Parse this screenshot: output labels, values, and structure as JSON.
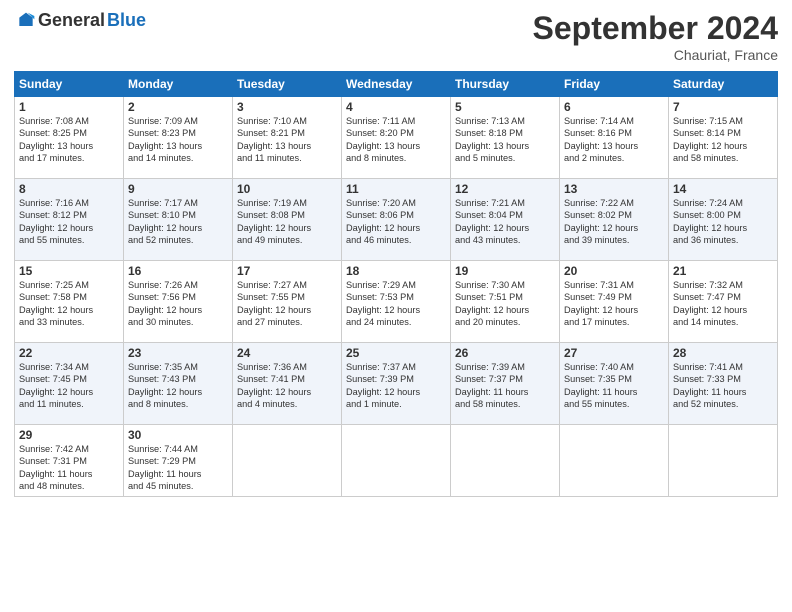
{
  "header": {
    "logo_general": "General",
    "logo_blue": "Blue",
    "month": "September 2024",
    "location": "Chauriat, France"
  },
  "weekdays": [
    "Sunday",
    "Monday",
    "Tuesday",
    "Wednesday",
    "Thursday",
    "Friday",
    "Saturday"
  ],
  "weeks": [
    [
      {
        "day": "1",
        "info": "Sunrise: 7:08 AM\nSunset: 8:25 PM\nDaylight: 13 hours\nand 17 minutes."
      },
      {
        "day": "2",
        "info": "Sunrise: 7:09 AM\nSunset: 8:23 PM\nDaylight: 13 hours\nand 14 minutes."
      },
      {
        "day": "3",
        "info": "Sunrise: 7:10 AM\nSunset: 8:21 PM\nDaylight: 13 hours\nand 11 minutes."
      },
      {
        "day": "4",
        "info": "Sunrise: 7:11 AM\nSunset: 8:20 PM\nDaylight: 13 hours\nand 8 minutes."
      },
      {
        "day": "5",
        "info": "Sunrise: 7:13 AM\nSunset: 8:18 PM\nDaylight: 13 hours\nand 5 minutes."
      },
      {
        "day": "6",
        "info": "Sunrise: 7:14 AM\nSunset: 8:16 PM\nDaylight: 13 hours\nand 2 minutes."
      },
      {
        "day": "7",
        "info": "Sunrise: 7:15 AM\nSunset: 8:14 PM\nDaylight: 12 hours\nand 58 minutes."
      }
    ],
    [
      {
        "day": "8",
        "info": "Sunrise: 7:16 AM\nSunset: 8:12 PM\nDaylight: 12 hours\nand 55 minutes."
      },
      {
        "day": "9",
        "info": "Sunrise: 7:17 AM\nSunset: 8:10 PM\nDaylight: 12 hours\nand 52 minutes."
      },
      {
        "day": "10",
        "info": "Sunrise: 7:19 AM\nSunset: 8:08 PM\nDaylight: 12 hours\nand 49 minutes."
      },
      {
        "day": "11",
        "info": "Sunrise: 7:20 AM\nSunset: 8:06 PM\nDaylight: 12 hours\nand 46 minutes."
      },
      {
        "day": "12",
        "info": "Sunrise: 7:21 AM\nSunset: 8:04 PM\nDaylight: 12 hours\nand 43 minutes."
      },
      {
        "day": "13",
        "info": "Sunrise: 7:22 AM\nSunset: 8:02 PM\nDaylight: 12 hours\nand 39 minutes."
      },
      {
        "day": "14",
        "info": "Sunrise: 7:24 AM\nSunset: 8:00 PM\nDaylight: 12 hours\nand 36 minutes."
      }
    ],
    [
      {
        "day": "15",
        "info": "Sunrise: 7:25 AM\nSunset: 7:58 PM\nDaylight: 12 hours\nand 33 minutes."
      },
      {
        "day": "16",
        "info": "Sunrise: 7:26 AM\nSunset: 7:56 PM\nDaylight: 12 hours\nand 30 minutes."
      },
      {
        "day": "17",
        "info": "Sunrise: 7:27 AM\nSunset: 7:55 PM\nDaylight: 12 hours\nand 27 minutes."
      },
      {
        "day": "18",
        "info": "Sunrise: 7:29 AM\nSunset: 7:53 PM\nDaylight: 12 hours\nand 24 minutes."
      },
      {
        "day": "19",
        "info": "Sunrise: 7:30 AM\nSunset: 7:51 PM\nDaylight: 12 hours\nand 20 minutes."
      },
      {
        "day": "20",
        "info": "Sunrise: 7:31 AM\nSunset: 7:49 PM\nDaylight: 12 hours\nand 17 minutes."
      },
      {
        "day": "21",
        "info": "Sunrise: 7:32 AM\nSunset: 7:47 PM\nDaylight: 12 hours\nand 14 minutes."
      }
    ],
    [
      {
        "day": "22",
        "info": "Sunrise: 7:34 AM\nSunset: 7:45 PM\nDaylight: 12 hours\nand 11 minutes."
      },
      {
        "day": "23",
        "info": "Sunrise: 7:35 AM\nSunset: 7:43 PM\nDaylight: 12 hours\nand 8 minutes."
      },
      {
        "day": "24",
        "info": "Sunrise: 7:36 AM\nSunset: 7:41 PM\nDaylight: 12 hours\nand 4 minutes."
      },
      {
        "day": "25",
        "info": "Sunrise: 7:37 AM\nSunset: 7:39 PM\nDaylight: 12 hours\nand 1 minute."
      },
      {
        "day": "26",
        "info": "Sunrise: 7:39 AM\nSunset: 7:37 PM\nDaylight: 11 hours\nand 58 minutes."
      },
      {
        "day": "27",
        "info": "Sunrise: 7:40 AM\nSunset: 7:35 PM\nDaylight: 11 hours\nand 55 minutes."
      },
      {
        "day": "28",
        "info": "Sunrise: 7:41 AM\nSunset: 7:33 PM\nDaylight: 11 hours\nand 52 minutes."
      }
    ],
    [
      {
        "day": "29",
        "info": "Sunrise: 7:42 AM\nSunset: 7:31 PM\nDaylight: 11 hours\nand 48 minutes."
      },
      {
        "day": "30",
        "info": "Sunrise: 7:44 AM\nSunset: 7:29 PM\nDaylight: 11 hours\nand 45 minutes."
      },
      {
        "day": "",
        "info": ""
      },
      {
        "day": "",
        "info": ""
      },
      {
        "day": "",
        "info": ""
      },
      {
        "day": "",
        "info": ""
      },
      {
        "day": "",
        "info": ""
      }
    ]
  ]
}
